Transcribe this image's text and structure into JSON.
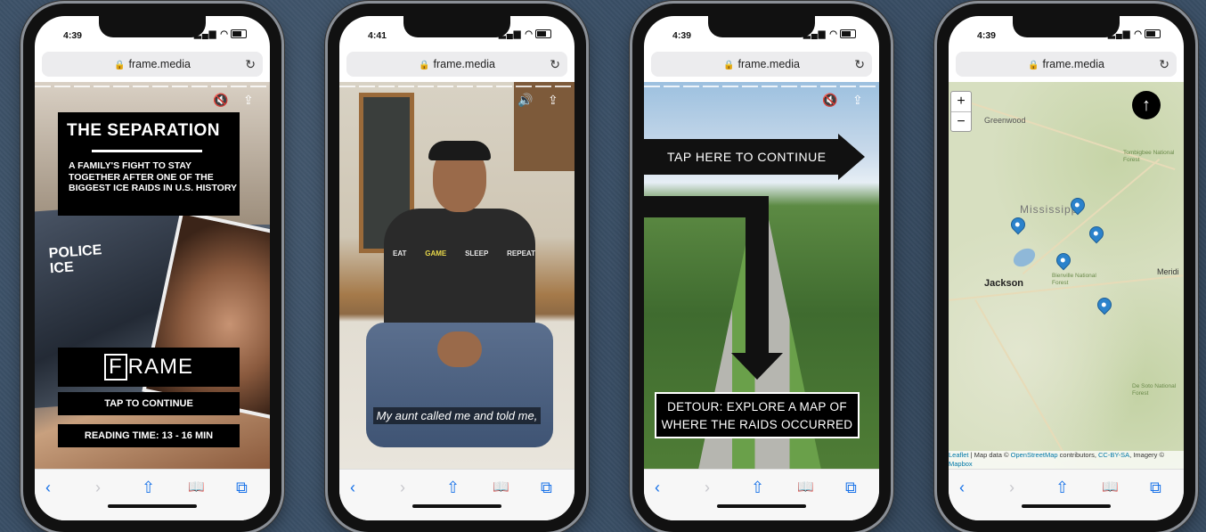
{
  "phones": [
    {
      "time": "4:39",
      "url": "frame.media",
      "title": "THE SEPARATION",
      "subtitle": "A FAMILY'S FIGHT TO STAY TOGETHER AFTER ONE OF THE BIGGEST ICE RAIDS IN U.S. HISTORY",
      "logo_letter": "F",
      "logo_rest": "RAME",
      "cta": "TAP TO CONTINUE",
      "reading_time": "READING TIME: 13 - 16 MIN",
      "badge_police": "POLICE",
      "badge_ice": "ICE"
    },
    {
      "time": "4:41",
      "url": "frame.media",
      "caption": "My aunt called me and told me,",
      "shirt_words": [
        "EAT",
        "GAME",
        "SLEEP",
        "REPEAT"
      ]
    },
    {
      "time": "4:39",
      "url": "frame.media",
      "arrow_label": "TAP HERE TO CONTINUE",
      "detour_line1": "DETOUR: EXPLORE A MAP OF",
      "detour_line2": "WHERE THE RAIDS OCCURRED"
    },
    {
      "time": "4:39",
      "url": "frame.media",
      "zoom_in": "+",
      "zoom_out": "−",
      "labels": {
        "greenwood": "Greenwood",
        "mississippi": "Mississippi",
        "jackson": "Jackson",
        "meridian": "Meridi",
        "tombigbee": "Tombigbee National Forest",
        "bienville": "Bienville National Forest",
        "desoto": "De Soto National Forest"
      },
      "attribution": {
        "leaflet": "Leaflet",
        "map_data": " | Map data © ",
        "osm": "OpenStreetMap",
        "contributors": " contributors, ",
        "license": "CC-BY-SA",
        "imagery": ", Imagery © ",
        "mapbox": "Mapbox"
      }
    }
  ],
  "toolbar": {
    "back": "‹",
    "forward": "›",
    "share": "⇧",
    "bookmarks": "📖",
    "tabs": "⧉"
  },
  "colors": {
    "background": "#3a4f66",
    "pin": "#2b82cb",
    "toolbar_icon": "#1a73e8"
  }
}
